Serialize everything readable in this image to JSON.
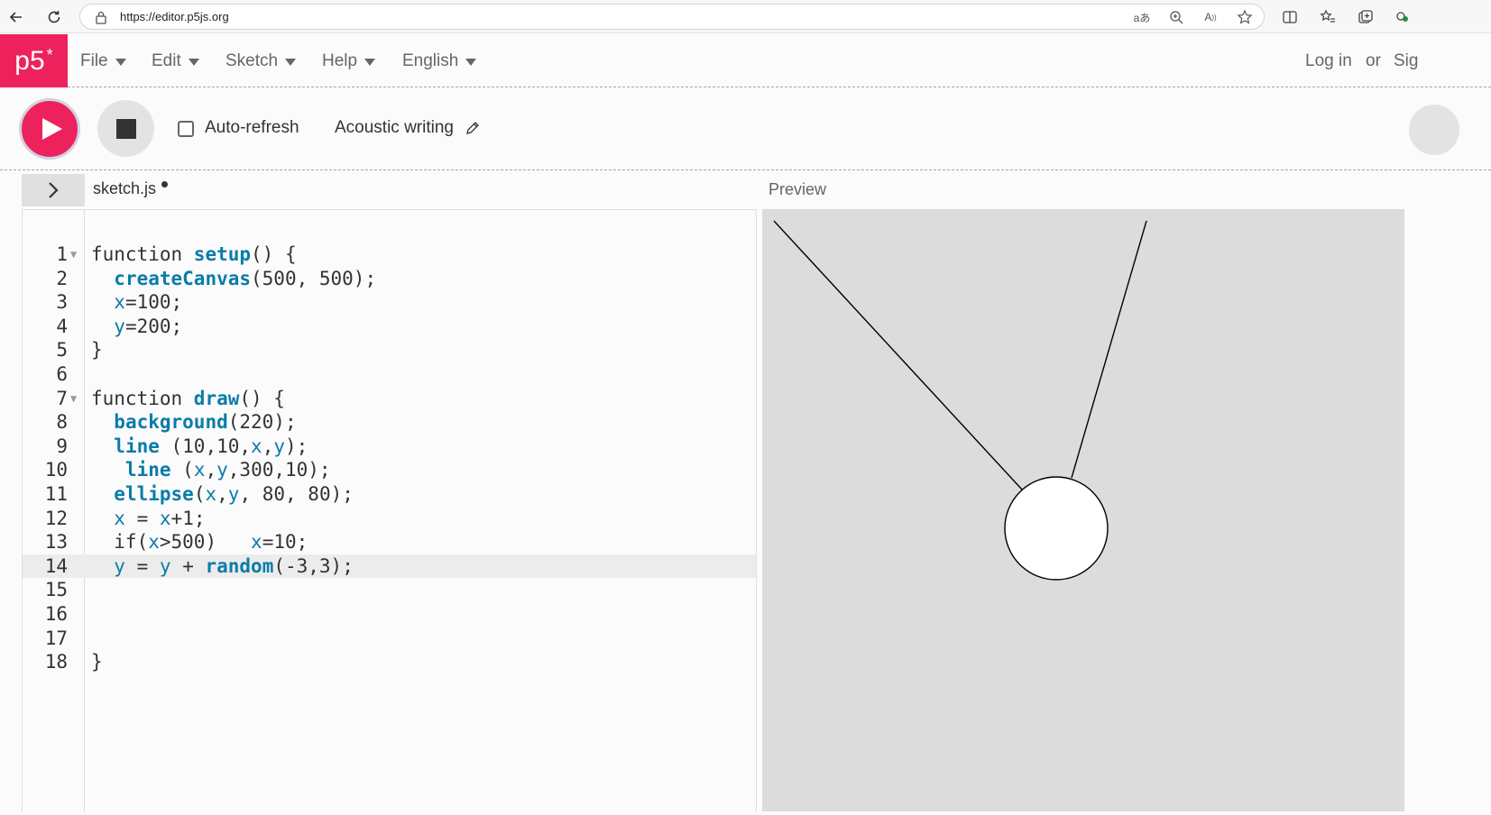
{
  "browser": {
    "url": "https://editor.p5js.org"
  },
  "nav": {
    "logo": "p5",
    "logo_star": "*",
    "menus": [
      {
        "label": "File"
      },
      {
        "label": "Edit"
      },
      {
        "label": "Sketch"
      },
      {
        "label": "Help"
      },
      {
        "label": "English"
      }
    ],
    "login": "Log in",
    "or": "or",
    "signup_partial": "Sig"
  },
  "toolbar": {
    "autorefresh_label": "Auto-refresh",
    "autorefresh_checked": false,
    "sketch_name": "Acoustic writing"
  },
  "editor": {
    "file_name": "sketch.js",
    "active_line": 14,
    "lines": [
      {
        "n": "1",
        "fold": true,
        "tokens": [
          [
            "kw",
            "function "
          ],
          [
            "fn",
            "setup"
          ],
          [
            "plain",
            "() {"
          ]
        ]
      },
      {
        "n": "2",
        "fold": false,
        "tokens": [
          [
            "plain",
            "  "
          ],
          [
            "fn",
            "createCanvas"
          ],
          [
            "plain",
            "(500, 500);"
          ]
        ]
      },
      {
        "n": "3",
        "fold": false,
        "tokens": [
          [
            "plain",
            "  "
          ],
          [
            "var",
            "x"
          ],
          [
            "plain",
            "=100;"
          ]
        ]
      },
      {
        "n": "4",
        "fold": false,
        "tokens": [
          [
            "plain",
            "  "
          ],
          [
            "var",
            "y"
          ],
          [
            "plain",
            "=200;"
          ]
        ]
      },
      {
        "n": "5",
        "fold": false,
        "tokens": [
          [
            "plain",
            "}"
          ]
        ]
      },
      {
        "n": "6",
        "fold": false,
        "tokens": []
      },
      {
        "n": "7",
        "fold": true,
        "tokens": [
          [
            "kw",
            "function "
          ],
          [
            "fn",
            "draw"
          ],
          [
            "plain",
            "() {"
          ]
        ]
      },
      {
        "n": "8",
        "fold": false,
        "tokens": [
          [
            "plain",
            "  "
          ],
          [
            "fn",
            "background"
          ],
          [
            "plain",
            "(220);"
          ]
        ]
      },
      {
        "n": "9",
        "fold": false,
        "tokens": [
          [
            "plain",
            "  "
          ],
          [
            "fn",
            "line"
          ],
          [
            "plain",
            " (10,10,"
          ],
          [
            "var",
            "x"
          ],
          [
            "plain",
            ","
          ],
          [
            "var",
            "y"
          ],
          [
            "plain",
            ");"
          ]
        ]
      },
      {
        "n": "10",
        "fold": false,
        "tokens": [
          [
            "plain",
            "   "
          ],
          [
            "fn",
            "line"
          ],
          [
            "plain",
            " ("
          ],
          [
            "var",
            "x"
          ],
          [
            "plain",
            ","
          ],
          [
            "var",
            "y"
          ],
          [
            "plain",
            ",300,10);"
          ]
        ]
      },
      {
        "n": "11",
        "fold": false,
        "tokens": [
          [
            "plain",
            "  "
          ],
          [
            "fn",
            "ellipse"
          ],
          [
            "plain",
            "("
          ],
          [
            "var",
            "x"
          ],
          [
            "plain",
            ","
          ],
          [
            "var",
            "y"
          ],
          [
            "plain",
            ", 80, 80);"
          ]
        ]
      },
      {
        "n": "12",
        "fold": false,
        "tokens": [
          [
            "plain",
            "  "
          ],
          [
            "var",
            "x"
          ],
          [
            "plain",
            " = "
          ],
          [
            "var",
            "x"
          ],
          [
            "plain",
            "+1;"
          ]
        ]
      },
      {
        "n": "13",
        "fold": false,
        "tokens": [
          [
            "plain",
            "  if("
          ],
          [
            "var",
            "x"
          ],
          [
            "plain",
            ">500)   "
          ],
          [
            "var",
            "x"
          ],
          [
            "plain",
            "=10;"
          ]
        ]
      },
      {
        "n": "14",
        "fold": false,
        "tokens": [
          [
            "plain",
            "  "
          ],
          [
            "var",
            "y"
          ],
          [
            "plain",
            " = "
          ],
          [
            "var",
            "y"
          ],
          [
            "plain",
            " + "
          ],
          [
            "fn",
            "random"
          ],
          [
            "plain",
            "(-3,3);"
          ]
        ]
      },
      {
        "n": "15",
        "fold": false,
        "tokens": []
      },
      {
        "n": "16",
        "fold": false,
        "tokens": []
      },
      {
        "n": "17",
        "fold": false,
        "tokens": []
      },
      {
        "n": "18",
        "fold": false,
        "tokens": [
          [
            "plain",
            "}"
          ]
        ]
      }
    ]
  },
  "preview": {
    "label": "Preview",
    "background": "#dcdcdc"
  },
  "colors": {
    "brand": "#ed225d",
    "code_function": "#0b7ca9",
    "code_text": "#333333"
  }
}
